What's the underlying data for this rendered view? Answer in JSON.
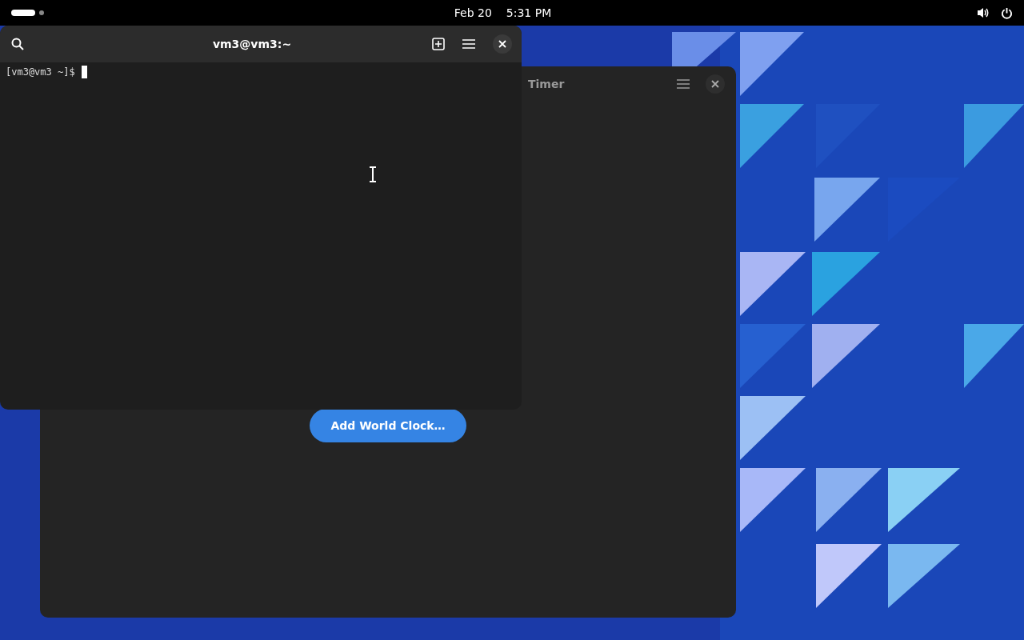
{
  "top_bar": {
    "date": "Feb 20",
    "time": "5:31 PM"
  },
  "clocks_window": {
    "tab_label": "Timer",
    "add_button": "Add World Clock…"
  },
  "terminal_window": {
    "title": "vm3@vm3:~",
    "prompt": "[vm3@vm3 ~]$"
  }
}
